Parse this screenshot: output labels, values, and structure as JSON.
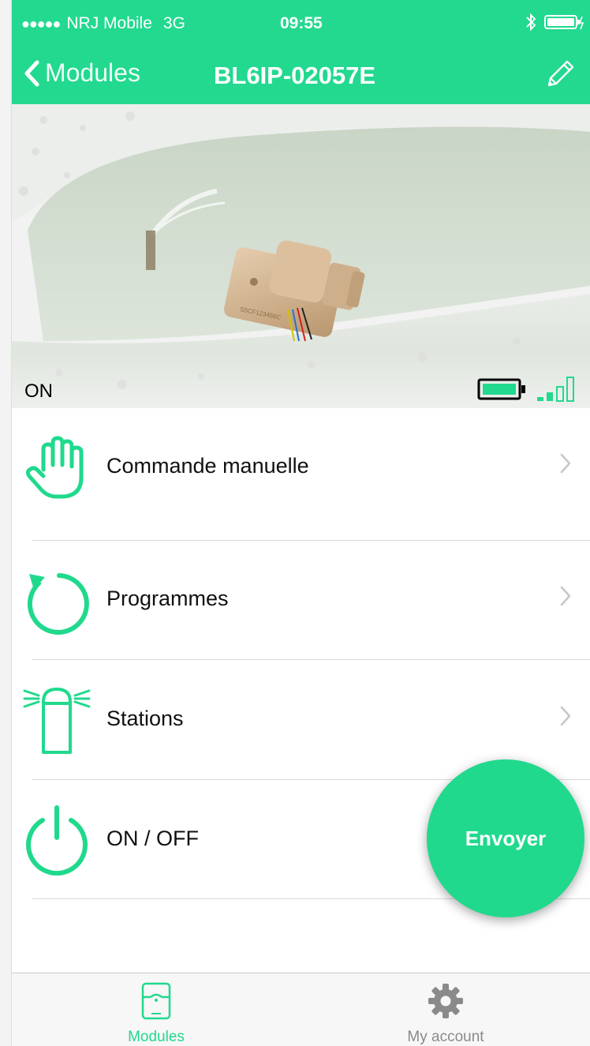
{
  "status_bar": {
    "carrier": "NRJ Mobile",
    "network": "3G",
    "time": "09:55"
  },
  "nav": {
    "back_label": "Modules",
    "title": "BL6IP-02057E"
  },
  "device": {
    "state": "ON"
  },
  "menu": {
    "items": [
      {
        "label": "Commande manuelle",
        "icon": "hand-icon"
      },
      {
        "label": "Programmes",
        "icon": "refresh-icon"
      },
      {
        "label": "Stations",
        "icon": "sprinkler-icon"
      },
      {
        "label": "ON / OFF",
        "icon": "power-icon"
      }
    ]
  },
  "fab": {
    "label": "Envoyer"
  },
  "tabbar": {
    "tabs": [
      {
        "label": "Modules",
        "icon": "module-icon",
        "active": true
      },
      {
        "label": "My account",
        "icon": "gear-icon",
        "active": false
      }
    ]
  },
  "colors": {
    "accent": "#22d98f",
    "chevron": "#c7c7cc",
    "tab_inactive": "#8a8a8a"
  }
}
